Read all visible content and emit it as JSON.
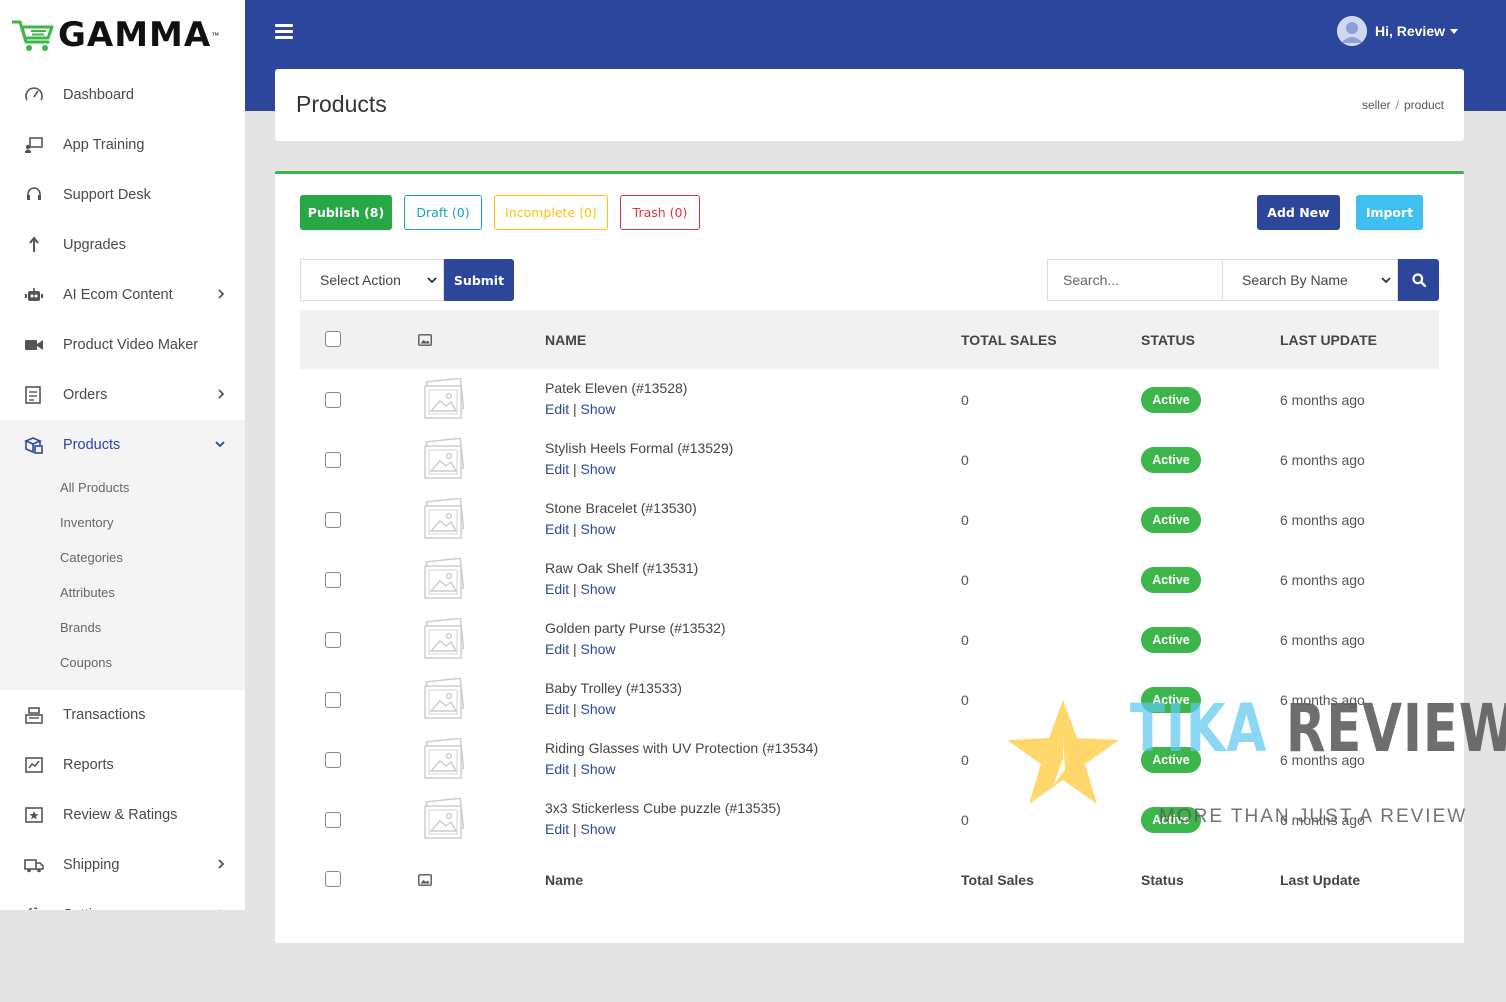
{
  "brand": {
    "name": "GAMMA",
    "tm": "™"
  },
  "sidebar": {
    "items": [
      {
        "label": "Dashboard",
        "icon": "gauge-icon",
        "chevron": false
      },
      {
        "label": "App Training",
        "icon": "training-icon",
        "chevron": false
      },
      {
        "label": "Support Desk",
        "icon": "headset-icon",
        "chevron": false
      },
      {
        "label": "Upgrades",
        "icon": "upgrade-arrow-icon",
        "chevron": false
      },
      {
        "label": "AI Ecom Content",
        "icon": "robot-icon",
        "chevron": true
      },
      {
        "label": "Product Video Maker",
        "icon": "video-camera-icon",
        "chevron": false
      },
      {
        "label": "Orders",
        "icon": "orders-icon",
        "chevron": true
      }
    ],
    "active": {
      "label": "Products",
      "icon": "boxes-icon",
      "subitems": [
        "All Products",
        "Inventory",
        "Categories",
        "Attributes",
        "Brands",
        "Coupons"
      ]
    },
    "items_after": [
      {
        "label": "Transactions",
        "icon": "cash-register-icon",
        "chevron": false
      },
      {
        "label": "Reports",
        "icon": "reports-icon",
        "chevron": false
      },
      {
        "label": "Review & Ratings",
        "icon": "review-icon",
        "chevron": false
      },
      {
        "label": "Shipping",
        "icon": "truck-icon",
        "chevron": true
      },
      {
        "label": "Settings",
        "icon": "gear-icon",
        "chevron": true
      }
    ]
  },
  "header": {
    "greeting": "Hi, Review"
  },
  "page": {
    "title": "Products",
    "breadcrumb": [
      "seller",
      "product"
    ]
  },
  "filters": {
    "publish": "Publish (8)",
    "draft": "Draft (0)",
    "incomplete": "Incomplete (0)",
    "trash": "Trash (0)"
  },
  "actions": {
    "add_new": "Add New",
    "import": "Import",
    "select_action": "Select Action",
    "submit": "Submit",
    "search_placeholder": "Search...",
    "search_by": "Search By Name"
  },
  "table": {
    "headers": {
      "name": "NAME",
      "total_sales": "TOTAL SALES",
      "status": "STATUS",
      "last_update": "LAST UPDATE"
    },
    "footers": {
      "name": "Name",
      "total_sales": "Total Sales",
      "status": "Status",
      "last_update": "Last Update"
    },
    "rows": [
      {
        "name": "Patek Eleven (#13528)",
        "edit": "Edit",
        "show": "Show",
        "sales": "0",
        "status": "Active",
        "updated": "6 months ago"
      },
      {
        "name": "Stylish Heels Formal (#13529)",
        "edit": "Edit",
        "show": "Show",
        "sales": "0",
        "status": "Active",
        "updated": "6 months ago"
      },
      {
        "name": "Stone Bracelet (#13530)",
        "edit": "Edit",
        "show": "Show",
        "sales": "0",
        "status": "Active",
        "updated": "6 months ago"
      },
      {
        "name": "Raw Oak Shelf (#13531)",
        "edit": "Edit",
        "show": "Show",
        "sales": "0",
        "status": "Active",
        "updated": "6 months ago"
      },
      {
        "name": "Golden party Purse (#13532)",
        "edit": "Edit",
        "show": "Show",
        "sales": "0",
        "status": "Active",
        "updated": "6 months ago"
      },
      {
        "name": "Baby Trolley (#13533)",
        "edit": "Edit",
        "show": "Show",
        "sales": "0",
        "status": "Active",
        "updated": "6 months ago"
      },
      {
        "name": "Riding Glasses with UV Protection (#13534)",
        "edit": "Edit",
        "show": "Show",
        "sales": "0",
        "status": "Active",
        "updated": "6 months ago"
      },
      {
        "name": "3x3 Stickerless Cube puzzle (#13535)",
        "edit": "Edit",
        "show": "Show",
        "sales": "0",
        "status": "Active",
        "updated": "6 months ago"
      }
    ]
  },
  "watermark": {
    "word1": "TIKA",
    "word2": "REVIEW",
    "tagline": "MORE THAN JUST A REVIEW"
  },
  "colors": {
    "primary": "#2c469b",
    "success": "#3cb54a",
    "info": "#17a2b8",
    "warning": "#ffc107",
    "danger": "#dc3545",
    "light_blue": "#40c0f0"
  }
}
